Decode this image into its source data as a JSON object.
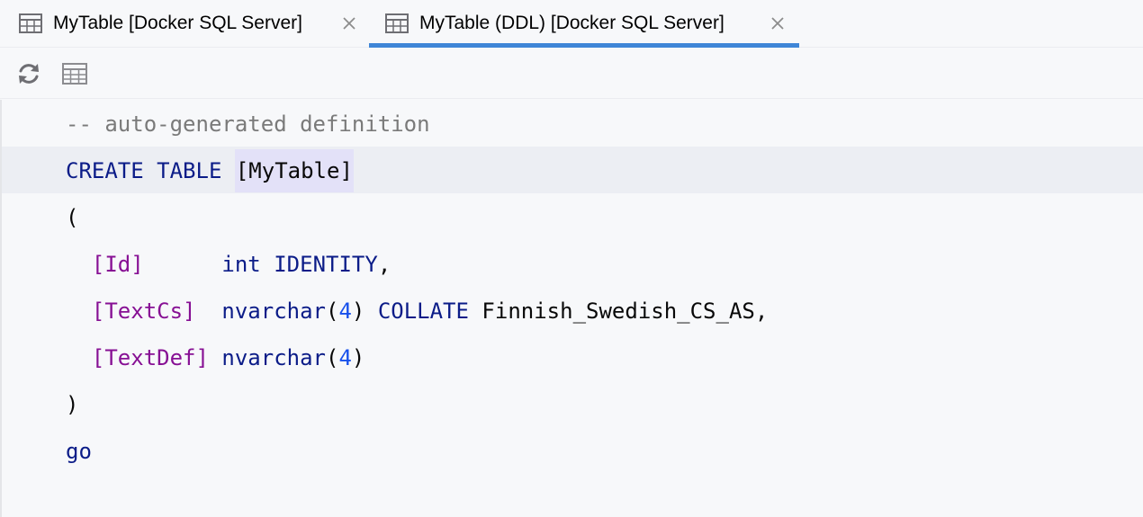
{
  "tabs": [
    {
      "label": "MyTable [Docker SQL Server]",
      "icon": "table-icon",
      "active": false
    },
    {
      "label": "MyTable (DDL) [Docker SQL Server]",
      "icon": "table-icon",
      "active": true
    }
  ],
  "toolbar": {
    "buttons": [
      {
        "name": "refresh",
        "icon": "refresh-icon"
      },
      {
        "name": "view-table",
        "icon": "table-icon"
      }
    ]
  },
  "colors": {
    "keyword": "#0b1c88",
    "comment": "#7a7a7a",
    "column": "#871094",
    "number": "#1750eb",
    "active_tab_underline": "#3f86d7"
  },
  "editor": {
    "comment": "-- auto-generated definition",
    "create_kw": "CREATE",
    "table_kw": "TABLE",
    "table_name": "[MyTable]",
    "open_paren": "(",
    "col1_name": "[Id]",
    "col1_type": "int",
    "col1_identity": "IDENTITY",
    "col1_comma": ",",
    "col2_name": "[TextCs]",
    "col2_type": "nvarchar",
    "col2_lp": "(",
    "col2_len": "4",
    "col2_rp": ")",
    "col2_collate": "COLLATE",
    "col2_collation": "Finnish_Swedish_CS_AS",
    "col2_comma": ",",
    "col3_name": "[TextDef]",
    "col3_type": "nvarchar",
    "col3_lp": "(",
    "col3_len": "4",
    "col3_rp": ")",
    "close_paren": ")",
    "go_kw": "go"
  }
}
